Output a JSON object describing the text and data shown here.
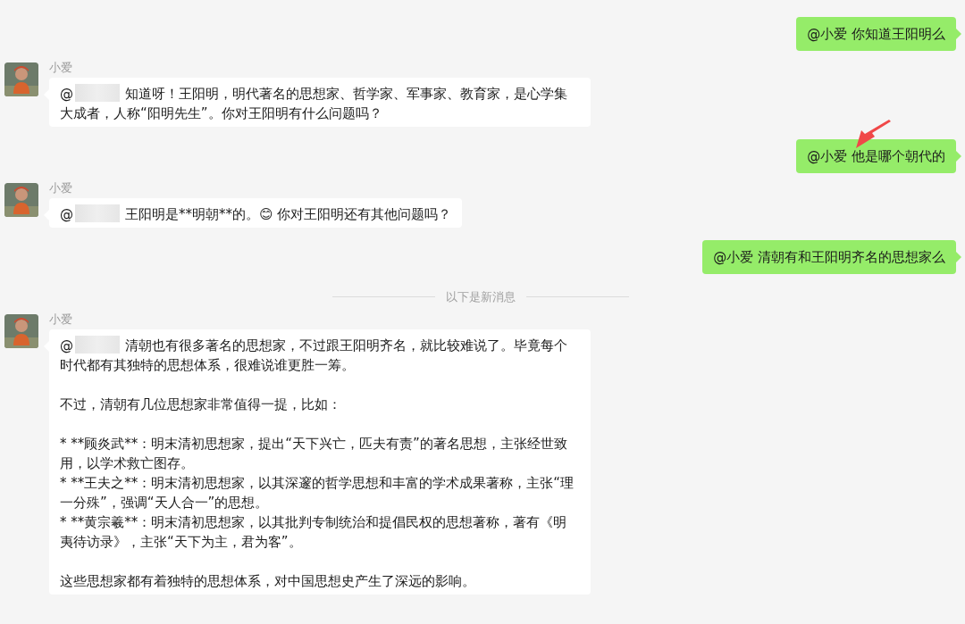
{
  "messages": [
    {
      "kind": "sent",
      "text": "@小爱 你知道王阳明么",
      "annotation_arrow": false
    },
    {
      "kind": "received",
      "sender": "小爱",
      "mention": "@",
      "redacted": true,
      "paragraphs": [
        [
          "知道呀！王阳明，明代著名的思想家、哲学家、军事家、教育家，是心学集大成者，人称“阳明先生”。你对王阳明有什么问题吗？"
        ]
      ]
    },
    {
      "kind": "sent",
      "text": "@小爱 他是哪个朝代的",
      "annotation_arrow": true
    },
    {
      "kind": "received",
      "sender": "小爱",
      "mention": "@",
      "redacted": true,
      "paragraphs": [
        [
          "王阳明是**明朝**的。😊 你对王阳明还有其他问题吗？"
        ]
      ]
    },
    {
      "kind": "sent",
      "text": "@小爱 清朝有和王阳明齐名的思想家么",
      "annotation_arrow": false
    },
    {
      "kind": "divider",
      "text": "以下是新消息"
    },
    {
      "kind": "received",
      "sender": "小爱",
      "mention": "@",
      "redacted": true,
      "paragraphs": [
        [
          "清朝也有很多著名的思想家，不过跟王阳明齐名，就比较难说了。毕竟每个时代都有其独特的思想体系，很难说谁更胜一筹。"
        ],
        [
          "不过，清朝有几位思想家非常值得一提，比如："
        ],
        [
          "* **顾炎武**：明末清初思想家，提出“天下兴亡，匹夫有责”的著名思想，主张经世致用，以学术救亡图存。",
          "* **王夫之**：明末清初思想家，以其深邃的哲学思想和丰富的学术成果著称，主张“理一分殊”，强调“天人合一”的思想。",
          "* **黄宗羲**：明末清初思想家，以其批判专制统治和提倡民权的思想著称，著有《明夷待访录》，主张“天下为主，君为客”。"
        ],
        [
          "这些思想家都有着独特的思想体系，对中国思想史产生了深远的影响。"
        ]
      ]
    }
  ]
}
